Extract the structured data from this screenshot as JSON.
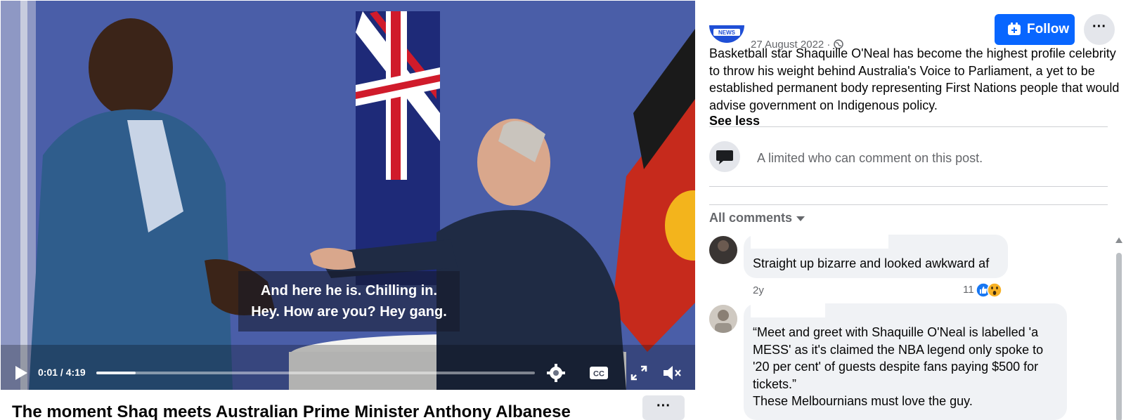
{
  "video": {
    "subtitle_line1": "And here he is. Chilling in.",
    "subtitle_line2": "Hey. How are you? Hey gang.",
    "time_display": "0:01 / 4:19",
    "progress_fraction": 0.09,
    "title": "The moment Shaq meets Australian Prime Minister Anthony Albanese",
    "more_label": "···"
  },
  "post": {
    "date": "27 August 2022 · ",
    "follow_label": "Follow",
    "more_label": "···",
    "text": "Basketball star Shaquille O'Neal has become the highest profile celebrity to throw his weight behind Australia's Voice to Parliament, a yet to be established permanent body representing First Nations people that would advise government on Indigenous policy.",
    "see_less_label": "See less",
    "comment_limit_text": "A                  limited who can comment on this post.",
    "all_comments_label": "All comments"
  },
  "comments": [
    {
      "text": "Straight up bizarre and looked awkward af",
      "age": "2y",
      "reaction_count": "11"
    },
    {
      "line1": "“Meet and greet with Shaquille O'Neal is labelled 'a",
      "line2": "MESS' as it's claimed the NBA legend only spoke to",
      "line3": "'20 per cent' of guests despite fans paying $500 for",
      "line4": "tickets.”",
      "line5": "These Melbournians must love the guy."
    }
  ],
  "colors": {
    "accent": "#0866ff",
    "video_backdrop": "#4457a3",
    "bubble": "#f0f2f5",
    "secondary_text": "#65676b"
  }
}
